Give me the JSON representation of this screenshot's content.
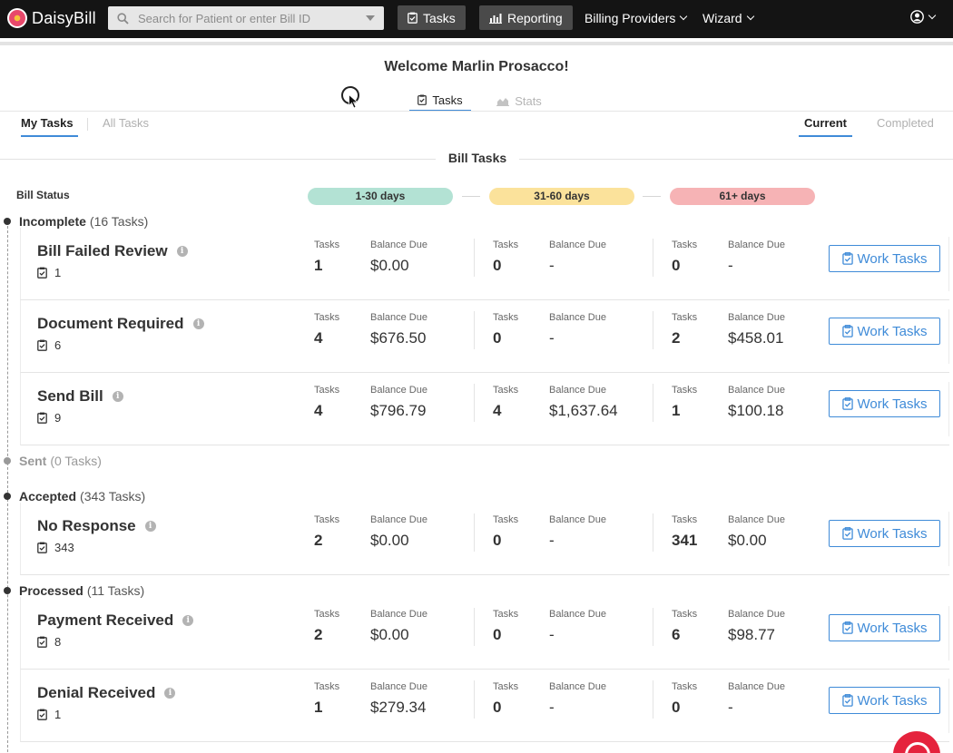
{
  "nav": {
    "logo_text": "DaisyBill",
    "search_placeholder": "Search for Patient or enter Bill ID",
    "tasks_label": "Tasks",
    "reporting_label": "Reporting",
    "billing_providers_label": "Billing Providers",
    "wizard_label": "Wizard"
  },
  "welcome": "Welcome Marlin Prosacco!",
  "page_tabs": {
    "tasks": "Tasks",
    "stats": "Stats"
  },
  "sub_tabs": {
    "my_tasks": "My Tasks",
    "all_tasks": "All Tasks",
    "current": "Current",
    "completed": "Completed"
  },
  "bill_tasks_title": "Bill Tasks",
  "bill_status_label": "Bill Status",
  "buckets": [
    "1-30 days",
    "31-60 days",
    "61+ days"
  ],
  "bucket_colors": [
    "#b3e2d4",
    "#fbe29b",
    "#f6b3b5"
  ],
  "cell_labels": {
    "tasks": "Tasks",
    "balance": "Balance Due"
  },
  "work_label": "Work Tasks",
  "groups": [
    {
      "name": "Incomplete",
      "count": "(16 Tasks)"
    },
    {
      "name": "Sent",
      "count": "(0 Tasks)"
    },
    {
      "name": "Accepted",
      "count": "(343 Tasks)"
    },
    {
      "name": "Processed",
      "count": "(11 Tasks)"
    }
  ],
  "rows": [
    {
      "title": "Bill Failed Review",
      "count": "1",
      "b": [
        {
          "tasks": "1",
          "balance": "$0.00"
        },
        {
          "tasks": "0",
          "balance": "-"
        },
        {
          "tasks": "0",
          "balance": "-"
        }
      ]
    },
    {
      "title": "Document Required",
      "count": "6",
      "b": [
        {
          "tasks": "4",
          "balance": "$676.50"
        },
        {
          "tasks": "0",
          "balance": "-"
        },
        {
          "tasks": "2",
          "balance": "$458.01"
        }
      ]
    },
    {
      "title": "Send Bill",
      "count": "9",
      "b": [
        {
          "tasks": "4",
          "balance": "$796.79"
        },
        {
          "tasks": "4",
          "balance": "$1,637.64"
        },
        {
          "tasks": "1",
          "balance": "$100.18"
        }
      ]
    },
    {
      "title": "No Response",
      "count": "343",
      "b": [
        {
          "tasks": "2",
          "balance": "$0.00"
        },
        {
          "tasks": "0",
          "balance": "-"
        },
        {
          "tasks": "341",
          "balance": "$0.00"
        }
      ]
    },
    {
      "title": "Payment Received",
      "count": "8",
      "b": [
        {
          "tasks": "2",
          "balance": "$0.00"
        },
        {
          "tasks": "0",
          "balance": "-"
        },
        {
          "tasks": "6",
          "balance": "$98.77"
        }
      ]
    },
    {
      "title": "Denial Received",
      "count": "1",
      "b": [
        {
          "tasks": "1",
          "balance": "$279.34"
        },
        {
          "tasks": "0",
          "balance": "-"
        },
        {
          "tasks": "0",
          "balance": "-"
        }
      ]
    }
  ]
}
